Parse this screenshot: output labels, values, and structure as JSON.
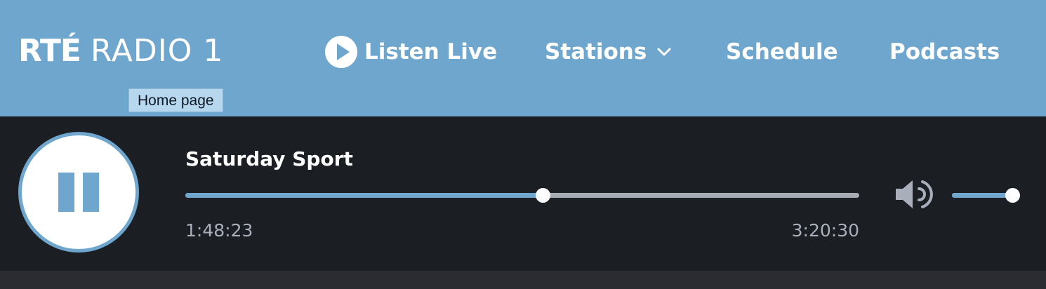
{
  "header": {
    "logo": {
      "brand": "RTÉ",
      "station": "RADIO 1"
    },
    "tooltip": "Home page",
    "nav": {
      "listen_live": "Listen Live",
      "stations": "Stations",
      "schedule": "Schedule",
      "podcasts": "Podcasts"
    }
  },
  "player": {
    "show_title": "Saturday Sport",
    "elapsed": "1:48:23",
    "duration": "3:20:30",
    "progress_fraction": 0.53,
    "volume_fraction": 1.0,
    "state": "playing"
  },
  "colors": {
    "header_bg": "#6ea6cd",
    "player_bg": "#1b1e22",
    "accent": "#6ea6cd",
    "track": "#a7abb3"
  },
  "icons": {
    "play": "play-circle-icon",
    "chevron": "chevron-down-icon",
    "pause": "pause-icon",
    "volume": "volume-icon"
  }
}
